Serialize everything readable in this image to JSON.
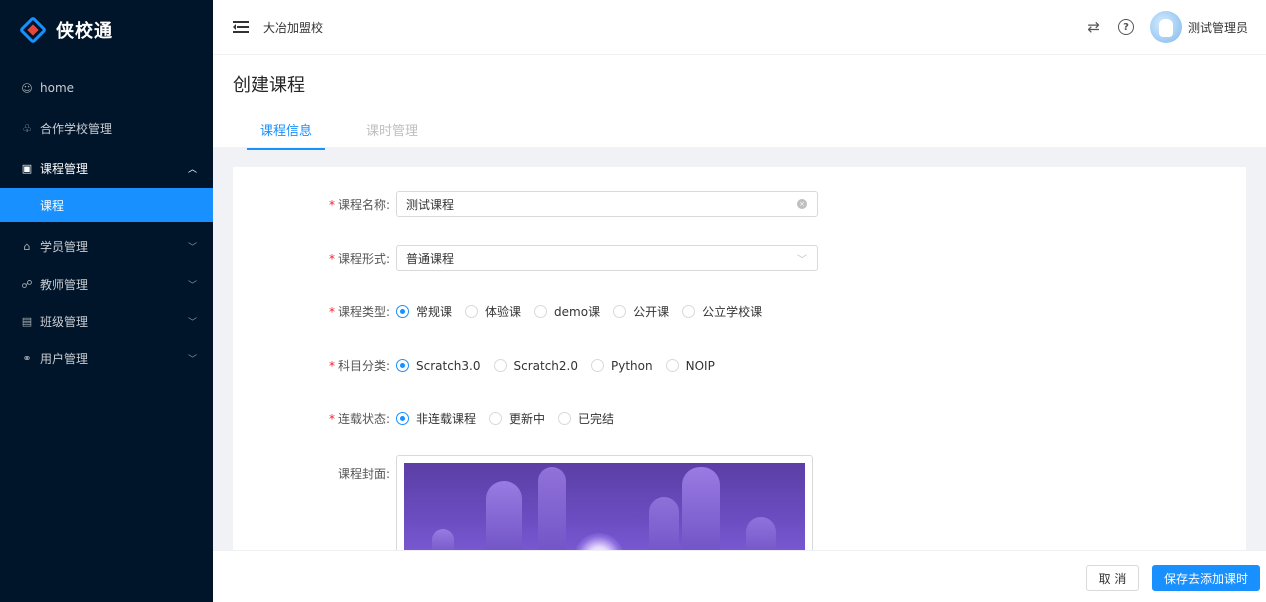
{
  "app": {
    "logo_text": "侠校通"
  },
  "sidebar": {
    "items": [
      {
        "label": "home",
        "icon": "smile-icon"
      },
      {
        "label": "合作学校管理",
        "icon": "cluster-icon"
      },
      {
        "label": "课程管理",
        "icon": "book-icon",
        "open": true
      },
      {
        "label": "学员管理",
        "icon": "user-icon"
      },
      {
        "label": "教师管理",
        "icon": "teacher-icon"
      },
      {
        "label": "班级管理",
        "icon": "class-icon"
      },
      {
        "label": "用户管理",
        "icon": "team-icon"
      }
    ],
    "subitem_active": "课程"
  },
  "header": {
    "school": "大冶加盟校",
    "user_name": "测试管理员"
  },
  "page": {
    "title": "创建课程",
    "tabs": [
      "课程信息",
      "课时管理"
    ]
  },
  "form": {
    "name_label": "课程名称:",
    "name_value": "测试课程",
    "form_label": "课程形式:",
    "form_value": "普通课程",
    "type_label": "课程类型:",
    "type_options": [
      "常规课",
      "体验课",
      "demo课",
      "公开课",
      "公立学校课"
    ],
    "subject_label": "科目分类:",
    "subject_options": [
      "Scratch3.0",
      "Scratch2.0",
      "Python",
      "NOIP"
    ],
    "status_label": "连载状态:",
    "status_options": [
      "非连载课程",
      "更新中",
      "已完结"
    ],
    "cover_label": "课程封面:"
  },
  "footer": {
    "cancel": "取 消",
    "save": "保存去添加课时"
  },
  "colors": {
    "primary": "#1890ff",
    "sidebar_bg": "#001529",
    "required": "#f5222d"
  }
}
